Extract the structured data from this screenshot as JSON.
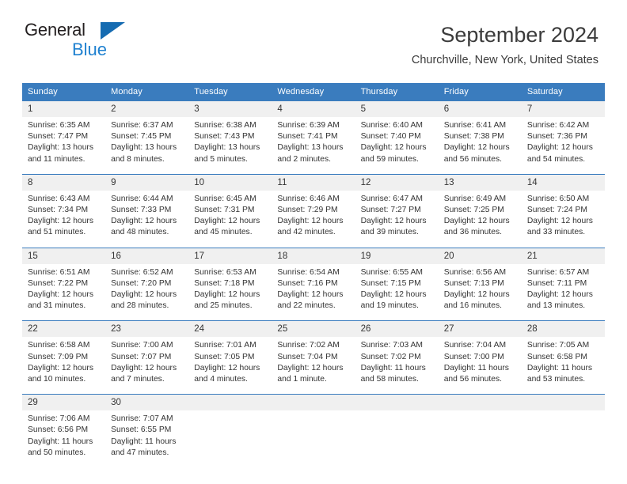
{
  "brand": {
    "name_part1": "General",
    "name_part2": "Blue",
    "triangle_color": "#156bb1",
    "blue_text_color": "#1f81d0"
  },
  "header": {
    "title": "September 2024",
    "subtitle": "Churchville, New York, United States"
  },
  "calendar": {
    "header_bg_color": "#3a7cbe",
    "day_number_bg_color": "#f0f0f0",
    "weekdays": [
      "Sunday",
      "Monday",
      "Tuesday",
      "Wednesday",
      "Thursday",
      "Friday",
      "Saturday"
    ],
    "weeks": [
      [
        {
          "day": "1",
          "sunrise": "Sunrise: 6:35 AM",
          "sunset": "Sunset: 7:47 PM",
          "daylight_line1": "Daylight: 13 hours",
          "daylight_line2": "and 11 minutes."
        },
        {
          "day": "2",
          "sunrise": "Sunrise: 6:37 AM",
          "sunset": "Sunset: 7:45 PM",
          "daylight_line1": "Daylight: 13 hours",
          "daylight_line2": "and 8 minutes."
        },
        {
          "day": "3",
          "sunrise": "Sunrise: 6:38 AM",
          "sunset": "Sunset: 7:43 PM",
          "daylight_line1": "Daylight: 13 hours",
          "daylight_line2": "and 5 minutes."
        },
        {
          "day": "4",
          "sunrise": "Sunrise: 6:39 AM",
          "sunset": "Sunset: 7:41 PM",
          "daylight_line1": "Daylight: 13 hours",
          "daylight_line2": "and 2 minutes."
        },
        {
          "day": "5",
          "sunrise": "Sunrise: 6:40 AM",
          "sunset": "Sunset: 7:40 PM",
          "daylight_line1": "Daylight: 12 hours",
          "daylight_line2": "and 59 minutes."
        },
        {
          "day": "6",
          "sunrise": "Sunrise: 6:41 AM",
          "sunset": "Sunset: 7:38 PM",
          "daylight_line1": "Daylight: 12 hours",
          "daylight_line2": "and 56 minutes."
        },
        {
          "day": "7",
          "sunrise": "Sunrise: 6:42 AM",
          "sunset": "Sunset: 7:36 PM",
          "daylight_line1": "Daylight: 12 hours",
          "daylight_line2": "and 54 minutes."
        }
      ],
      [
        {
          "day": "8",
          "sunrise": "Sunrise: 6:43 AM",
          "sunset": "Sunset: 7:34 PM",
          "daylight_line1": "Daylight: 12 hours",
          "daylight_line2": "and 51 minutes."
        },
        {
          "day": "9",
          "sunrise": "Sunrise: 6:44 AM",
          "sunset": "Sunset: 7:33 PM",
          "daylight_line1": "Daylight: 12 hours",
          "daylight_line2": "and 48 minutes."
        },
        {
          "day": "10",
          "sunrise": "Sunrise: 6:45 AM",
          "sunset": "Sunset: 7:31 PM",
          "daylight_line1": "Daylight: 12 hours",
          "daylight_line2": "and 45 minutes."
        },
        {
          "day": "11",
          "sunrise": "Sunrise: 6:46 AM",
          "sunset": "Sunset: 7:29 PM",
          "daylight_line1": "Daylight: 12 hours",
          "daylight_line2": "and 42 minutes."
        },
        {
          "day": "12",
          "sunrise": "Sunrise: 6:47 AM",
          "sunset": "Sunset: 7:27 PM",
          "daylight_line1": "Daylight: 12 hours",
          "daylight_line2": "and 39 minutes."
        },
        {
          "day": "13",
          "sunrise": "Sunrise: 6:49 AM",
          "sunset": "Sunset: 7:25 PM",
          "daylight_line1": "Daylight: 12 hours",
          "daylight_line2": "and 36 minutes."
        },
        {
          "day": "14",
          "sunrise": "Sunrise: 6:50 AM",
          "sunset": "Sunset: 7:24 PM",
          "daylight_line1": "Daylight: 12 hours",
          "daylight_line2": "and 33 minutes."
        }
      ],
      [
        {
          "day": "15",
          "sunrise": "Sunrise: 6:51 AM",
          "sunset": "Sunset: 7:22 PM",
          "daylight_line1": "Daylight: 12 hours",
          "daylight_line2": "and 31 minutes."
        },
        {
          "day": "16",
          "sunrise": "Sunrise: 6:52 AM",
          "sunset": "Sunset: 7:20 PM",
          "daylight_line1": "Daylight: 12 hours",
          "daylight_line2": "and 28 minutes."
        },
        {
          "day": "17",
          "sunrise": "Sunrise: 6:53 AM",
          "sunset": "Sunset: 7:18 PM",
          "daylight_line1": "Daylight: 12 hours",
          "daylight_line2": "and 25 minutes."
        },
        {
          "day": "18",
          "sunrise": "Sunrise: 6:54 AM",
          "sunset": "Sunset: 7:16 PM",
          "daylight_line1": "Daylight: 12 hours",
          "daylight_line2": "and 22 minutes."
        },
        {
          "day": "19",
          "sunrise": "Sunrise: 6:55 AM",
          "sunset": "Sunset: 7:15 PM",
          "daylight_line1": "Daylight: 12 hours",
          "daylight_line2": "and 19 minutes."
        },
        {
          "day": "20",
          "sunrise": "Sunrise: 6:56 AM",
          "sunset": "Sunset: 7:13 PM",
          "daylight_line1": "Daylight: 12 hours",
          "daylight_line2": "and 16 minutes."
        },
        {
          "day": "21",
          "sunrise": "Sunrise: 6:57 AM",
          "sunset": "Sunset: 7:11 PM",
          "daylight_line1": "Daylight: 12 hours",
          "daylight_line2": "and 13 minutes."
        }
      ],
      [
        {
          "day": "22",
          "sunrise": "Sunrise: 6:58 AM",
          "sunset": "Sunset: 7:09 PM",
          "daylight_line1": "Daylight: 12 hours",
          "daylight_line2": "and 10 minutes."
        },
        {
          "day": "23",
          "sunrise": "Sunrise: 7:00 AM",
          "sunset": "Sunset: 7:07 PM",
          "daylight_line1": "Daylight: 12 hours",
          "daylight_line2": "and 7 minutes."
        },
        {
          "day": "24",
          "sunrise": "Sunrise: 7:01 AM",
          "sunset": "Sunset: 7:05 PM",
          "daylight_line1": "Daylight: 12 hours",
          "daylight_line2": "and 4 minutes."
        },
        {
          "day": "25",
          "sunrise": "Sunrise: 7:02 AM",
          "sunset": "Sunset: 7:04 PM",
          "daylight_line1": "Daylight: 12 hours",
          "daylight_line2": "and 1 minute."
        },
        {
          "day": "26",
          "sunrise": "Sunrise: 7:03 AM",
          "sunset": "Sunset: 7:02 PM",
          "daylight_line1": "Daylight: 11 hours",
          "daylight_line2": "and 58 minutes."
        },
        {
          "day": "27",
          "sunrise": "Sunrise: 7:04 AM",
          "sunset": "Sunset: 7:00 PM",
          "daylight_line1": "Daylight: 11 hours",
          "daylight_line2": "and 56 minutes."
        },
        {
          "day": "28",
          "sunrise": "Sunrise: 7:05 AM",
          "sunset": "Sunset: 6:58 PM",
          "daylight_line1": "Daylight: 11 hours",
          "daylight_line2": "and 53 minutes."
        }
      ],
      [
        {
          "day": "29",
          "sunrise": "Sunrise: 7:06 AM",
          "sunset": "Sunset: 6:56 PM",
          "daylight_line1": "Daylight: 11 hours",
          "daylight_line2": "and 50 minutes."
        },
        {
          "day": "30",
          "sunrise": "Sunrise: 7:07 AM",
          "sunset": "Sunset: 6:55 PM",
          "daylight_line1": "Daylight: 11 hours",
          "daylight_line2": "and 47 minutes."
        },
        {
          "day": "",
          "sunrise": "",
          "sunset": "",
          "daylight_line1": "",
          "daylight_line2": ""
        },
        {
          "day": "",
          "sunrise": "",
          "sunset": "",
          "daylight_line1": "",
          "daylight_line2": ""
        },
        {
          "day": "",
          "sunrise": "",
          "sunset": "",
          "daylight_line1": "",
          "daylight_line2": ""
        },
        {
          "day": "",
          "sunrise": "",
          "sunset": "",
          "daylight_line1": "",
          "daylight_line2": ""
        },
        {
          "day": "",
          "sunrise": "",
          "sunset": "",
          "daylight_line1": "",
          "daylight_line2": ""
        }
      ]
    ]
  }
}
